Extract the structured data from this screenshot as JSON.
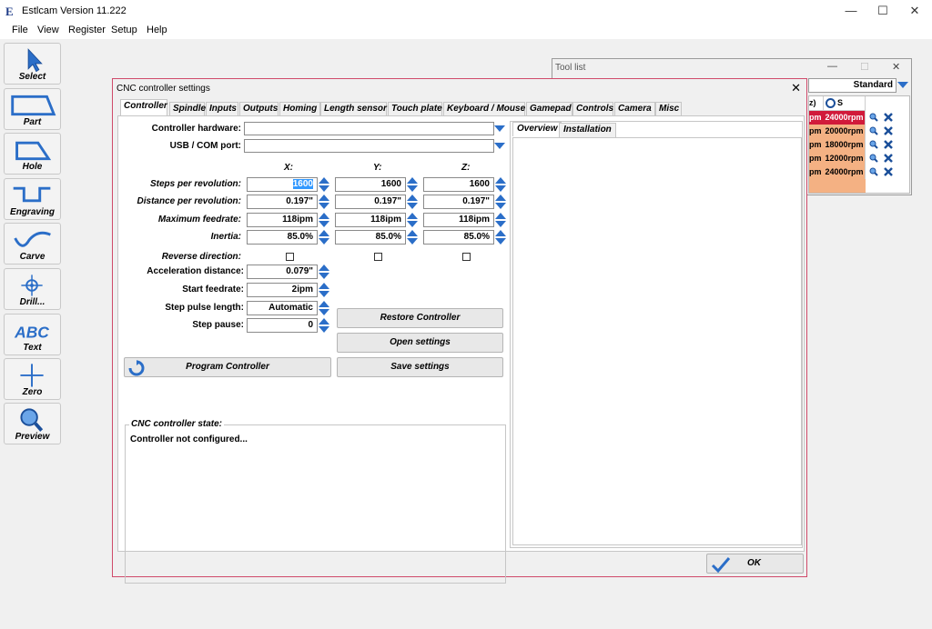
{
  "app": {
    "title": "Estlcam Version 11.222",
    "icon_letter": "E",
    "window_controls": {
      "minimize": "—",
      "maximize": "☐",
      "close": "✕"
    }
  },
  "menu": [
    "File",
    "View",
    "Register",
    "Setup",
    "Help"
  ],
  "toolbar": [
    {
      "label": "Select",
      "icon": "cursor-icon"
    },
    {
      "label": "Part",
      "icon": "part-icon"
    },
    {
      "label": "Hole",
      "icon": "hole-icon"
    },
    {
      "label": "Engraving",
      "icon": "engraving-icon"
    },
    {
      "label": "Carve",
      "icon": "carve-icon"
    },
    {
      "label": "Drill...",
      "icon": "drill-icon"
    },
    {
      "label": "Text",
      "icon": "text-icon"
    },
    {
      "label": "Zero",
      "icon": "zero-icon"
    },
    {
      "label": "Preview",
      "icon": "magnifier-icon"
    }
  ],
  "toollist": {
    "title": "Tool list",
    "preset": "Standard",
    "col_z": "z)",
    "col_s": "S",
    "rows": [
      {
        "f": "pm",
        "s": "24000rpm",
        "highlight": true
      },
      {
        "f": "pm",
        "s": "20000rpm",
        "highlight": false
      },
      {
        "f": "pm",
        "s": "18000rpm",
        "highlight": false
      },
      {
        "f": "pm",
        "s": "12000rpm",
        "highlight": false
      },
      {
        "f": "pm",
        "s": "24000rpm",
        "highlight": false
      }
    ]
  },
  "dialog": {
    "title": "CNC controller settings",
    "close": "✕",
    "tabs": [
      "Controller",
      "Spindle",
      "Inputs",
      "Outputs",
      "Homing",
      "Length sensor",
      "Touch plate",
      "Keyboard / Mouse",
      "Gamepad",
      "Controls",
      "Camera",
      "Misc"
    ],
    "controller_hardware_label": "Controller hardware:",
    "usb_port_label": "USB / COM port:",
    "axes": [
      "X:",
      "Y:",
      "Z:"
    ],
    "rows": [
      {
        "label": "Steps per revolution:",
        "values": [
          "1600",
          "1600",
          "1600"
        ]
      },
      {
        "label": "Distance per revolution:",
        "values": [
          "0.197\"",
          "0.197\"",
          "0.197\""
        ]
      },
      {
        "label": "Maximum feedrate:",
        "values": [
          "118ipm",
          "118ipm",
          "118ipm"
        ]
      },
      {
        "label": "Inertia:",
        "values": [
          "85.0%",
          "85.0%",
          "85.0%"
        ]
      }
    ],
    "reverse_direction_label": "Reverse direction:",
    "acceleration_distance": {
      "label": "Acceleration distance:",
      "value": "0.079\""
    },
    "start_feedrate": {
      "label": "Start feedrate:",
      "value": "2ipm"
    },
    "step_pulse_length": {
      "label": "Step pulse length:",
      "value": "Automatic"
    },
    "step_pause": {
      "label": "Step pause:",
      "value": "0"
    },
    "buttons": {
      "restore": "Restore Controller",
      "open": "Open settings",
      "save": "Save settings",
      "program": "Program Controller",
      "ok": "OK"
    },
    "state_title": "CNC controller  state:",
    "state_text": "Controller  not  configured...",
    "right_tabs": [
      "Overview",
      "Installation"
    ]
  },
  "colors": {
    "accent": "#2b6ec8",
    "dialog_border": "#d04a6a",
    "row_orange": "#f4b183",
    "row_red": "#d11a3a"
  }
}
